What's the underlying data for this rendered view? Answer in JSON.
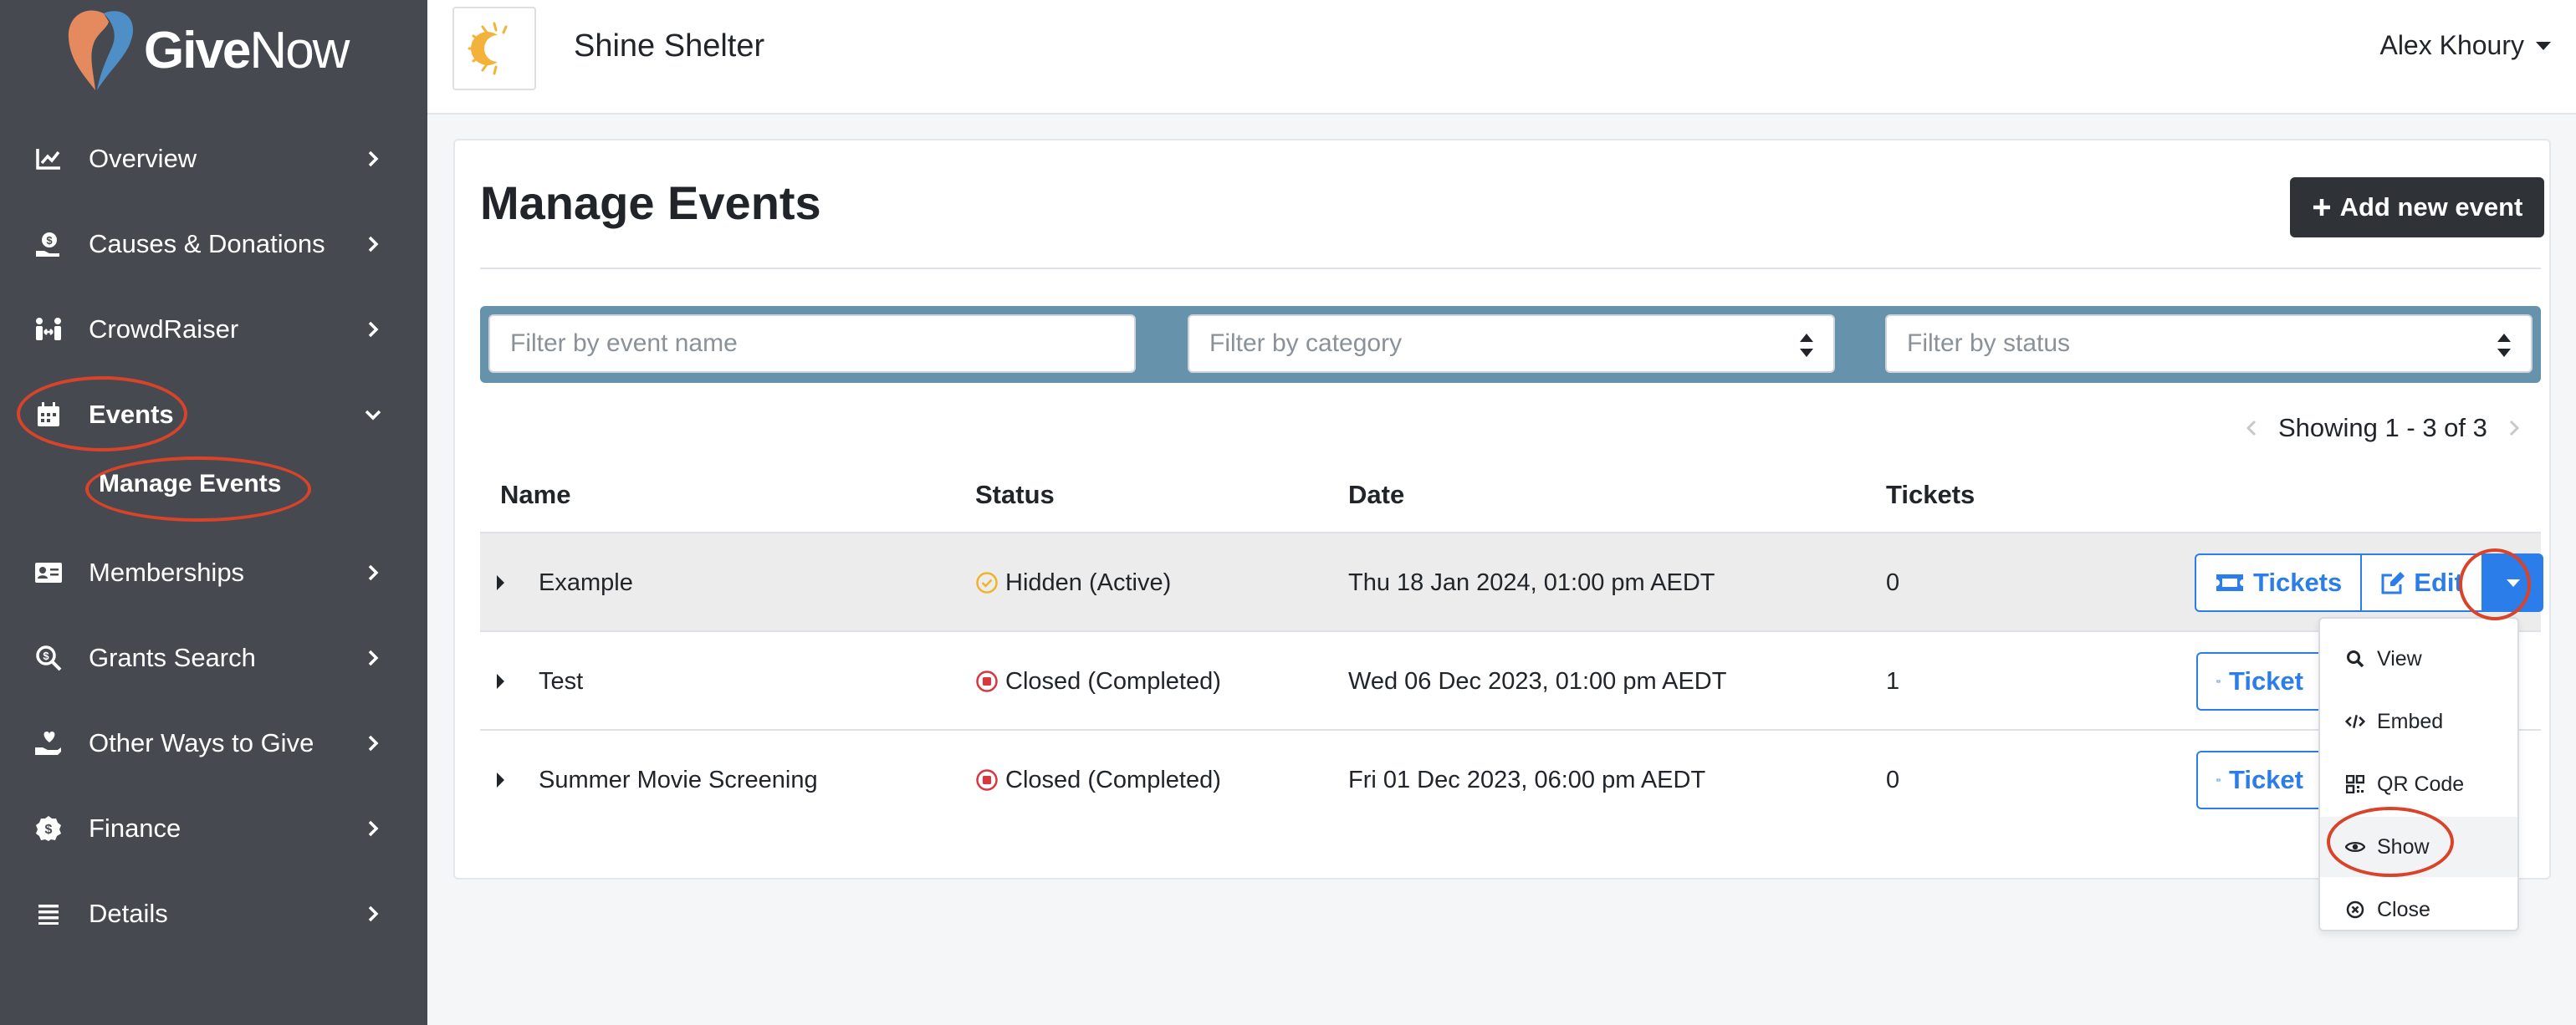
{
  "app": {
    "brand_bold": "Give",
    "brand_light": "Now"
  },
  "sidebar": {
    "items": [
      {
        "label": "Overview",
        "icon": "chart-line-icon"
      },
      {
        "label": "Causes & Donations",
        "icon": "donation-icon"
      },
      {
        "label": "CrowdRaiser",
        "icon": "people-arrows-icon"
      },
      {
        "label": "Events",
        "icon": "calendar-icon",
        "expanded": true
      },
      {
        "label": "Memberships",
        "icon": "id-card-icon"
      },
      {
        "label": "Grants Search",
        "icon": "search-dollar-icon"
      },
      {
        "label": "Other Ways to Give",
        "icon": "hand-heart-icon"
      },
      {
        "label": "Finance",
        "icon": "coin-icon"
      },
      {
        "label": "Details",
        "icon": "list-icon"
      }
    ],
    "sub_item": "Manage Events"
  },
  "header": {
    "org_name": "Shine Shelter",
    "user_name": "Alex Khoury"
  },
  "main": {
    "title": "Manage Events",
    "add_button": "Add new event",
    "filters": {
      "name_placeholder": "Filter by event name",
      "category_placeholder": "Filter by category",
      "status_placeholder": "Filter by status"
    },
    "pager": "Showing 1 - 3 of 3",
    "columns": [
      "Name",
      "Status",
      "Date",
      "Tickets"
    ],
    "rows": [
      {
        "name": "Example",
        "status": "Hidden (Active)",
        "status_type": "hidden",
        "date": "Thu 18 Jan 2024, 01:00 pm AEDT",
        "tickets": "0"
      },
      {
        "name": "Test",
        "status": "Closed (Completed)",
        "status_type": "closed",
        "date": "Wed 06 Dec 2023, 01:00 pm AEDT",
        "tickets": "1"
      },
      {
        "name": "Summer Movie Screening",
        "status": "Closed (Completed)",
        "status_type": "closed",
        "date": "Fri 01 Dec 2023, 06:00 pm AEDT",
        "tickets": "0"
      }
    ],
    "row_buttons": {
      "tickets": "Tickets",
      "tickets_truncated": "Ticket",
      "edit": "Edit"
    },
    "dropdown": [
      "View",
      "Embed",
      "QR Code",
      "Show",
      "Close"
    ]
  },
  "colors": {
    "sidebar_bg": "#464a50",
    "filter_bar": "#6792ac",
    "primary": "#2b7de9",
    "annotation": "#d9432a",
    "hidden_status": "#f0b429",
    "closed_status": "#d9363e",
    "dark_button": "#2f3337"
  }
}
